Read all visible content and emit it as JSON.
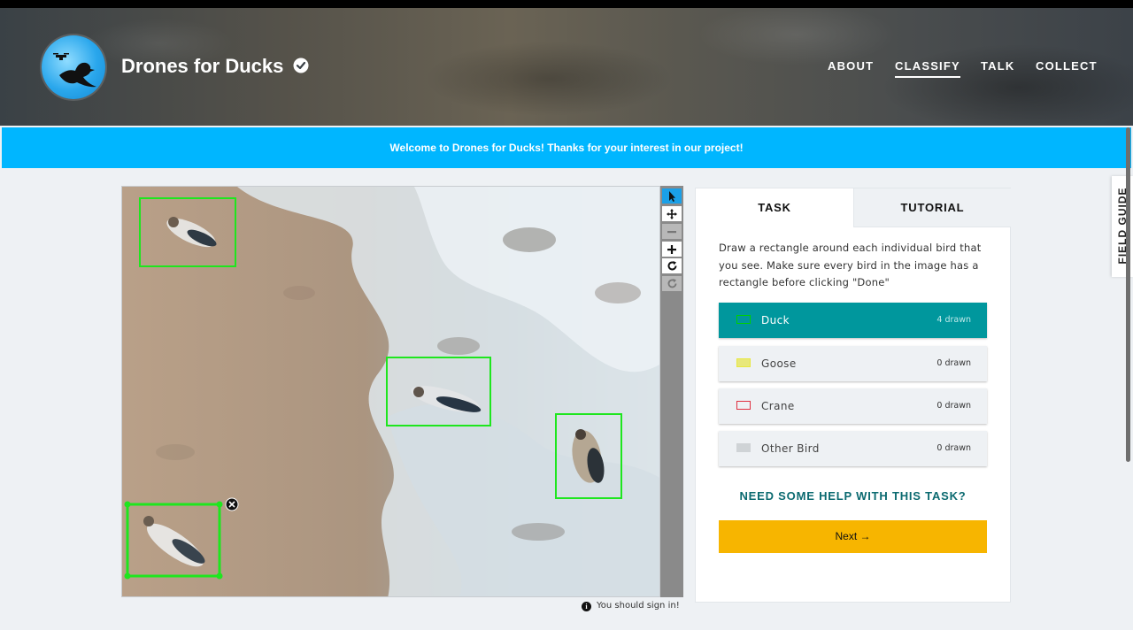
{
  "header": {
    "project_title": "Drones for Ducks",
    "icons": {
      "logo": "duck-drone-logo",
      "verified": "verified-badge-icon"
    },
    "nav": [
      {
        "label": "ABOUT",
        "active": false
      },
      {
        "label": "CLASSIFY",
        "active": true
      },
      {
        "label": "TALK",
        "active": false
      },
      {
        "label": "COLLECT",
        "active": false
      }
    ]
  },
  "banner": {
    "text": "Welcome to Drones for Ducks! Thanks for your interest in our project!"
  },
  "viewer": {
    "tools": [
      {
        "name": "pointer-icon",
        "active": true
      },
      {
        "name": "move-icon",
        "active": false
      },
      {
        "name": "zoom-out-icon",
        "active": false,
        "disabled": true
      },
      {
        "name": "zoom-in-icon",
        "active": false
      },
      {
        "name": "rotate-icon",
        "active": false
      },
      {
        "name": "reset-icon",
        "active": false,
        "disabled": true
      }
    ],
    "signin_notice": "You should sign in!"
  },
  "task_panel": {
    "tabs": [
      {
        "label": "TASK",
        "active": true
      },
      {
        "label": "TUTORIAL",
        "active": false
      }
    ],
    "instructions": "Draw a rectangle around each individual bird that you see. Make sure every bird in the image has a rectangle before clicking \"Done\"",
    "choices": [
      {
        "label": "Duck",
        "count": "4 drawn",
        "color": "#00d000",
        "selected": true
      },
      {
        "label": "Goose",
        "count": "0 drawn",
        "color": "#e8e840",
        "selected": false
      },
      {
        "label": "Crane",
        "count": "0 drawn",
        "color": "#e03040",
        "selected": false
      },
      {
        "label": "Other Bird",
        "count": "0 drawn",
        "color": "#cfd3d6",
        "selected": false
      }
    ],
    "help_link": "NEED SOME HELP WITH THIS TASK?",
    "next_button": "Next →"
  },
  "field_guide": {
    "label": "FIELD GUIDE"
  },
  "colors": {
    "banner": "#00b6ff",
    "selected_choice": "#00979d",
    "next_button": "#f7b500",
    "help_link": "#0b6a70"
  }
}
